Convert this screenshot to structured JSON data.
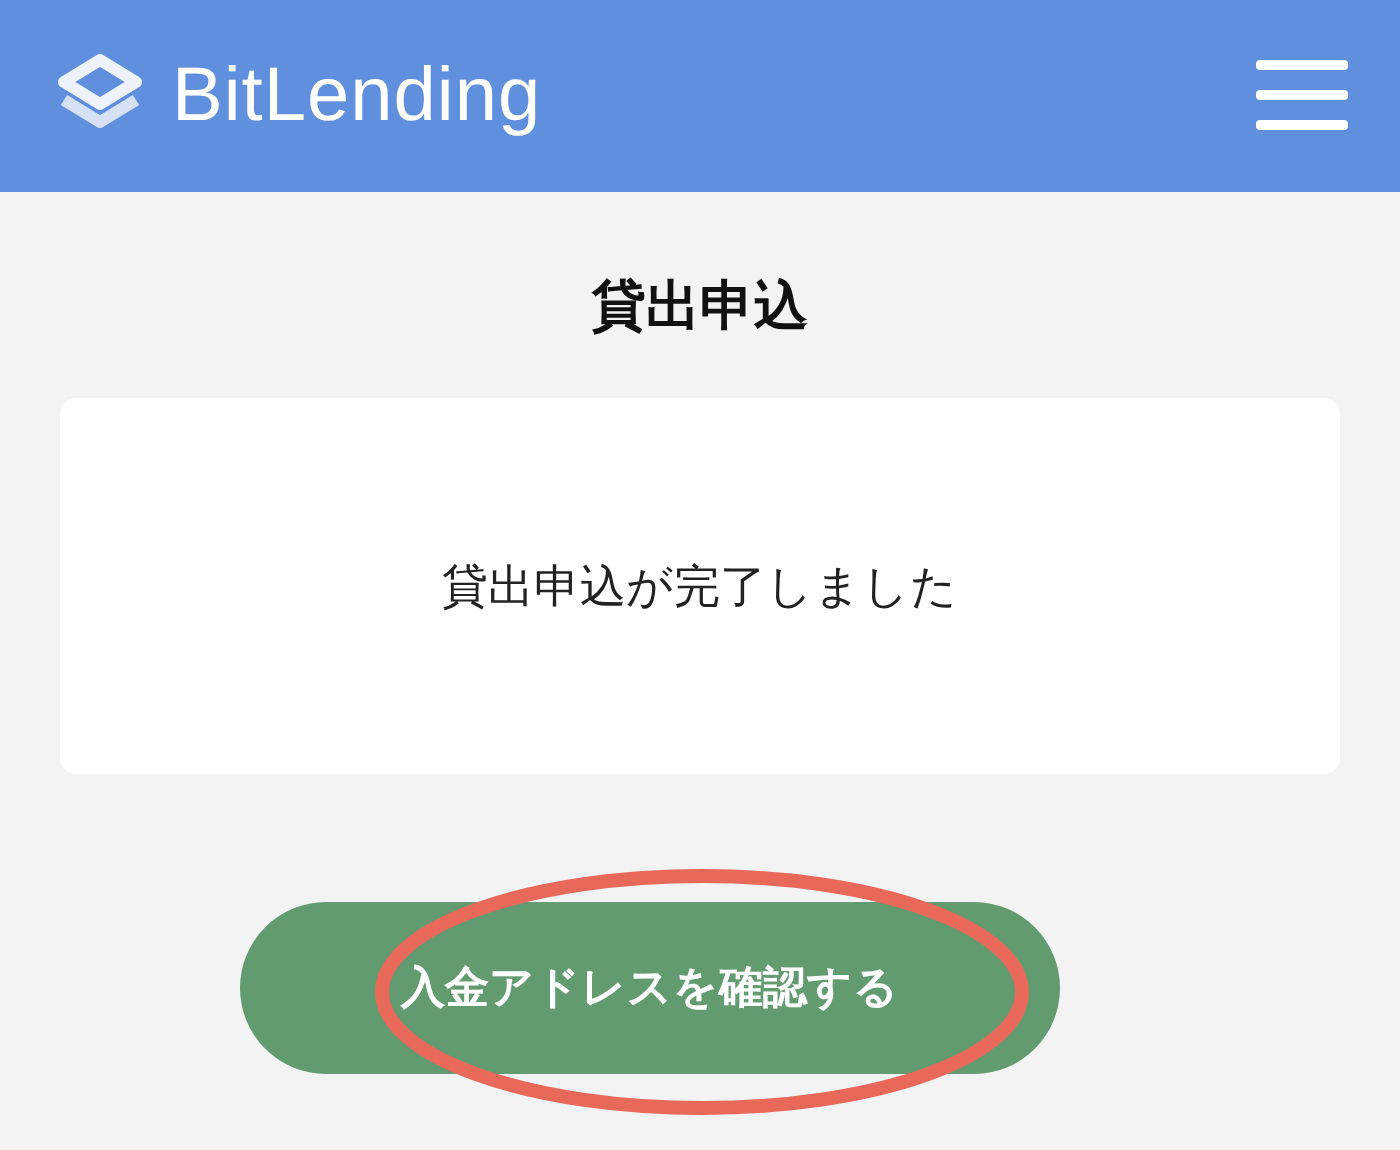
{
  "header": {
    "brand": "BitLending"
  },
  "page_title": "貸出申込",
  "message": "貸出申込が完了しました",
  "button": {
    "label": "入金アドレスを確認する"
  }
}
